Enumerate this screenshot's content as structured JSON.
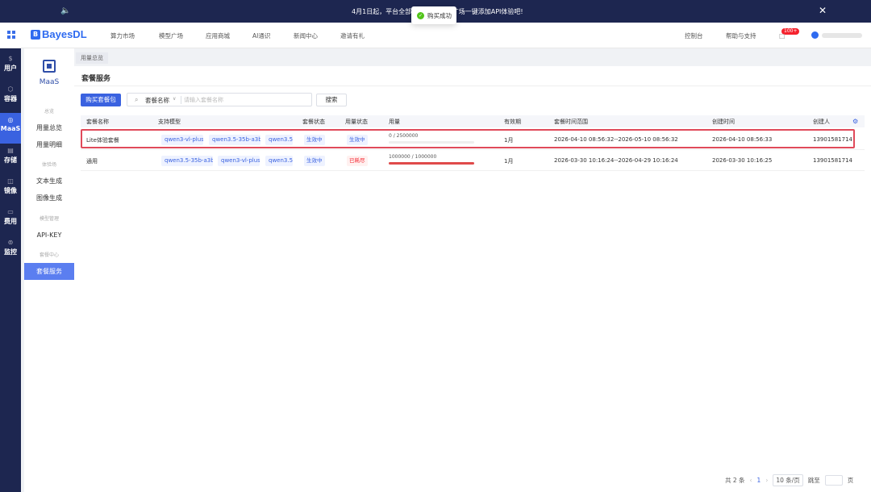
{
  "banner": {
    "text": "4月1日起，平台全部模型… 来模型广场一键添加API体验吧!"
  },
  "toast": {
    "text": "购买成功"
  },
  "topnav": {
    "logo": "BayesDL",
    "items": [
      "算力市场",
      "模型广场",
      "应用商城",
      "AI通识",
      "新闻中心",
      "邀请有礼"
    ],
    "console": "控制台",
    "help": "帮助与支持",
    "badge": "100+"
  },
  "rail": {
    "items": [
      {
        "label": "用户"
      },
      {
        "label": "容器"
      },
      {
        "label": "MaaS"
      },
      {
        "label": "存储"
      },
      {
        "label": "镜像"
      },
      {
        "label": "费用"
      },
      {
        "label": "监控"
      }
    ]
  },
  "side": {
    "title": "MaaS",
    "groups": [
      "总览",
      "体验场",
      "模型管理",
      "套餐中心"
    ],
    "items": [
      "用量总览",
      "用量明细",
      "文本生成",
      "图像生成",
      "API-KEY",
      "套餐服务"
    ]
  },
  "tab": "用量总览",
  "page": {
    "title": "套餐服务",
    "buy_button": "购买套餐包",
    "filter_select": "套餐名称",
    "search_placeholder": "请输入套餐名称",
    "search_button": "搜索"
  },
  "table": {
    "headers": [
      "套餐名称",
      "支持模型",
      "套餐状态",
      "用量状态",
      "用量",
      "有效期",
      "套餐时间范围",
      "创建时间",
      "创建人"
    ],
    "rows": [
      {
        "name": "Lite体验套餐",
        "models": [
          "qwen3-vl-plus",
          "qwen3.5-35b-a3b",
          "qwen3.5-"
        ],
        "status": "生效中",
        "usage_status": "生效中",
        "usage_text": "0 / 2500000",
        "usage_fraction": 0,
        "validity": "1月",
        "range": "2026-04-10 08:56:32--2026-05-10 08:56:32",
        "created": "2026-04-10 08:56:33",
        "creator": "13901581714"
      },
      {
        "name": "通用",
        "models": [
          "qwen3.5-35b-a3b",
          "qwen3-vl-plus",
          "qwen3.5-"
        ],
        "status": "生效中",
        "usage_status": "已耗尽",
        "usage_text": "1000000 / 1000000",
        "usage_fraction": 1,
        "validity": "1月",
        "range": "2026-03-30 10:16:24--2026-04-29 10:16:24",
        "created": "2026-03-30 10:16:25",
        "creator": "13901581714"
      }
    ]
  },
  "pager": {
    "total": "共 2 条",
    "current": "1",
    "size": "10 条/页",
    "goto": "跳至",
    "page_unit": "页"
  }
}
